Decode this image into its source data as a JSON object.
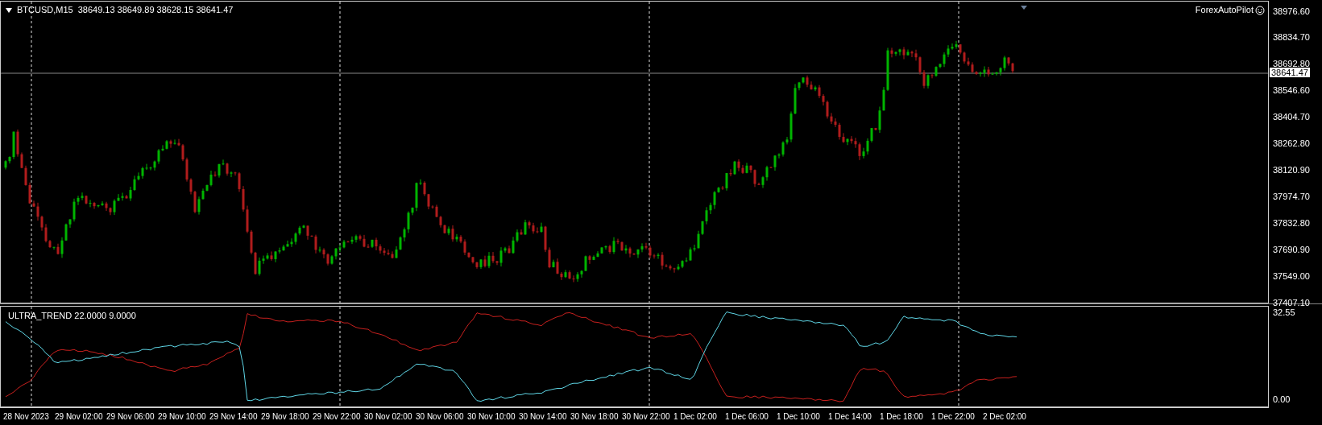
{
  "chart": {
    "symbol": "BTCUSD,M15",
    "quotes": "38649.13 38649.89 38628.15 38641.47",
    "expert": "ForexAutoPilot",
    "current_price": "38641.47",
    "price_axis": [
      "38976.60",
      "38834.70",
      "38692.80",
      "38546.60",
      "38404.70",
      "38262.80",
      "38120.90",
      "37974.70",
      "37832.80",
      "37690.90",
      "37549.00",
      "37407.10"
    ]
  },
  "indicator": {
    "name": "ULTRA_TREND 22.0000 9.0000",
    "axis": [
      "32.55",
      "0.00"
    ]
  },
  "time_axis": [
    "28 Nov 2023",
    "29 Nov 02:00",
    "29 Nov 06:00",
    "29 Nov 10:00",
    "29 Nov 14:00",
    "29 Nov 18:00",
    "29 Nov 22:00",
    "30 Nov 02:00",
    "30 Nov 06:00",
    "30 Nov 10:00",
    "30 Nov 14:00",
    "30 Nov 18:00",
    "30 Nov 22:00",
    "1 Dec 02:00",
    "1 Dec 06:00",
    "1 Dec 10:00",
    "1 Dec 14:00",
    "1 Dec 18:00",
    "1 Dec 22:00",
    "2 Dec 02:00"
  ]
}
